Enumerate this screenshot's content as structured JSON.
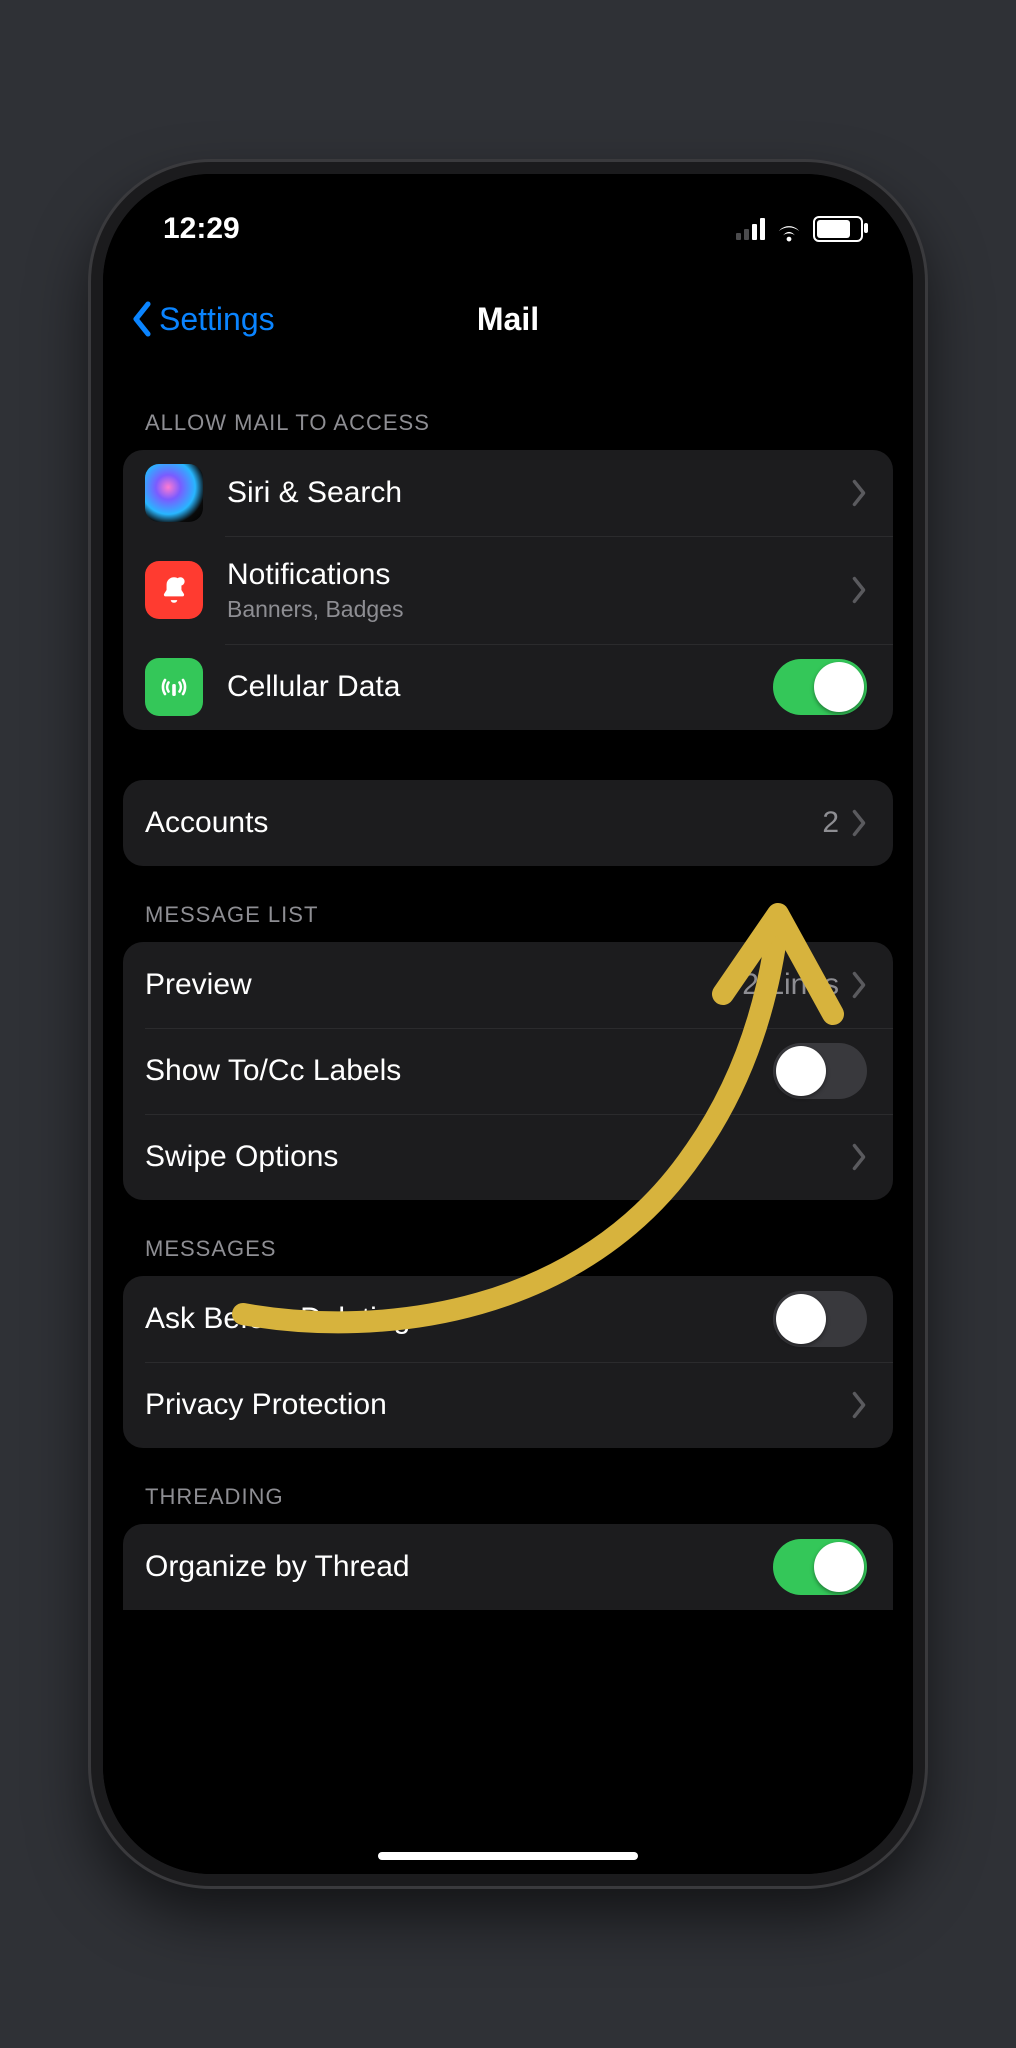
{
  "status": {
    "time": "12:29"
  },
  "nav": {
    "back": "Settings",
    "title": "Mail"
  },
  "sections": {
    "access": {
      "header": "ALLOW MAIL TO ACCESS",
      "siri": "Siri & Search",
      "notifications": {
        "title": "Notifications",
        "detail": "Banners, Badges"
      },
      "cellular": {
        "title": "Cellular Data",
        "on": true
      }
    },
    "accounts": {
      "title": "Accounts",
      "count": "2"
    },
    "message_list": {
      "header": "MESSAGE LIST",
      "preview": {
        "title": "Preview",
        "value": "2 Lines"
      },
      "tocc": {
        "title": "Show To/Cc Labels",
        "on": false
      },
      "swipe": "Swipe Options"
    },
    "messages": {
      "header": "MESSAGES",
      "ask": {
        "title": "Ask Before Deleting",
        "on": false
      },
      "privacy": "Privacy Protection"
    },
    "threading": {
      "header": "THREADING",
      "organize": {
        "title": "Organize by Thread",
        "on": true
      }
    }
  }
}
